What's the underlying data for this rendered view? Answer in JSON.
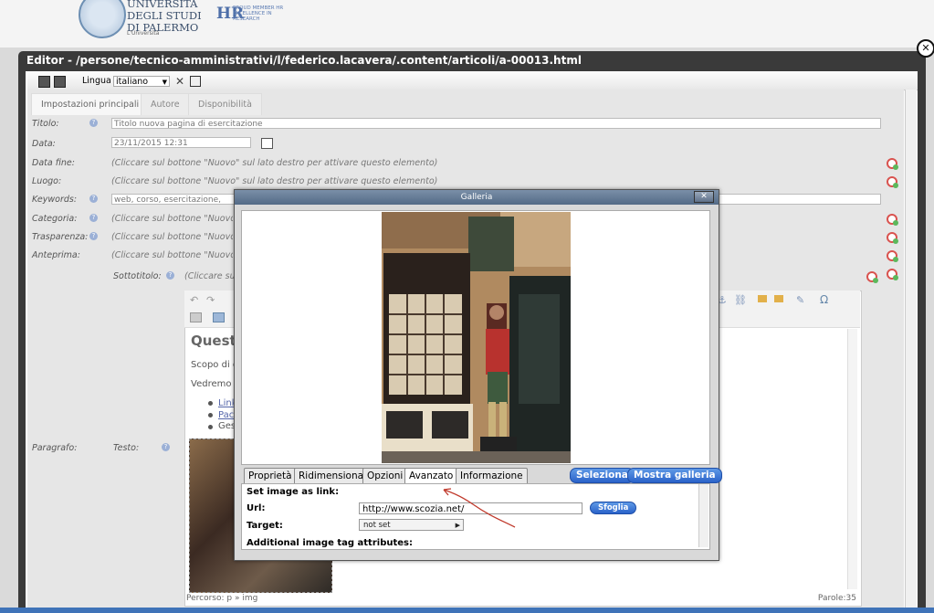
{
  "header": {
    "university_name_lines": [
      "UNIVERSITÀ",
      "DEGLI STUDI",
      "DI PALERMO"
    ],
    "university_sub": "L'Università",
    "hr_logo": "HR",
    "hr_text": "PROUD MEMBER HR EXCELLENCE IN RESEARCH"
  },
  "window": {
    "title": "Editor - /persone/tecnico-amministrativi/l/federico.lacavera/.content/articoli/a-00013.html",
    "close_label": "✕"
  },
  "toolbar": {
    "lingua_label": "Lingua",
    "lingua_value": "italiano"
  },
  "tabs": [
    {
      "label": "Impostazioni principali",
      "active": true
    },
    {
      "label": "Autore",
      "active": false
    },
    {
      "label": "Disponibilità",
      "active": false
    }
  ],
  "fields": {
    "titolo": {
      "label": "Titolo:",
      "value": "Titolo nuova pagina di esercitazione"
    },
    "data": {
      "label": "Data:",
      "value": "23/11/2015 12:31"
    },
    "data_fine": {
      "label": "Data fine:",
      "hint": "(Cliccare sul bottone \"Nuovo\" sul lato destro per attivare questo elemento)"
    },
    "luogo": {
      "label": "Luogo:",
      "hint": "(Cliccare sul bottone \"Nuovo\" sul lato destro per attivare questo elemento)"
    },
    "keywords": {
      "label": "Keywords:",
      "value": "web, corso, esercitazione,"
    },
    "categoria": {
      "label": "Categoria:",
      "hint": "(Cliccare sul bottone \"Nuovo\" s"
    },
    "trasparenza": {
      "label": "Trasparenza:",
      "hint": "(Cliccare sul bottone \"Nuovo\" s"
    },
    "anteprima": {
      "label": "Anteprima:",
      "hint": "(Cliccare sul bottone \"Nuovo\" s"
    },
    "sottotitolo": {
      "label": "Sottotitolo:",
      "hint": "(Cliccare sul"
    },
    "paragrafo": {
      "label": "Paragrafo:"
    },
    "testo": {
      "label": "Testo:"
    }
  },
  "editor": {
    "heading": "Questo",
    "line1": "Scopo di q",
    "line2": "Vedremo c",
    "links": [
      "Link",
      "Pac"
    ],
    "bullet3": "Ges",
    "path": "Percorso: p » img",
    "word_count": "Parole:35"
  },
  "dialog": {
    "title": "Galleria",
    "close": "✕",
    "tabs": [
      {
        "label": "Proprietà",
        "active": false
      },
      {
        "label": "Ridimensiona",
        "active": false
      },
      {
        "label": "Opzioni",
        "active": false
      },
      {
        "label": "Avanzato",
        "active": true
      },
      {
        "label": "Informazione",
        "active": false
      }
    ],
    "seleziona": "Seleziona",
    "mostra_galleria": "Mostra galleria",
    "set_image_link": "Set image as link:",
    "url_label": "Url:",
    "url_value": "http://www.scozia.net/",
    "sfoglia": "Sfoglia",
    "target_label": "Target:",
    "target_value": "not set",
    "additional": "Additional image tag attributes:"
  },
  "colors": {
    "accent_blue": "#2a62c9",
    "window_dark": "#3a3a3a",
    "annotation_red": "#c0392b"
  }
}
